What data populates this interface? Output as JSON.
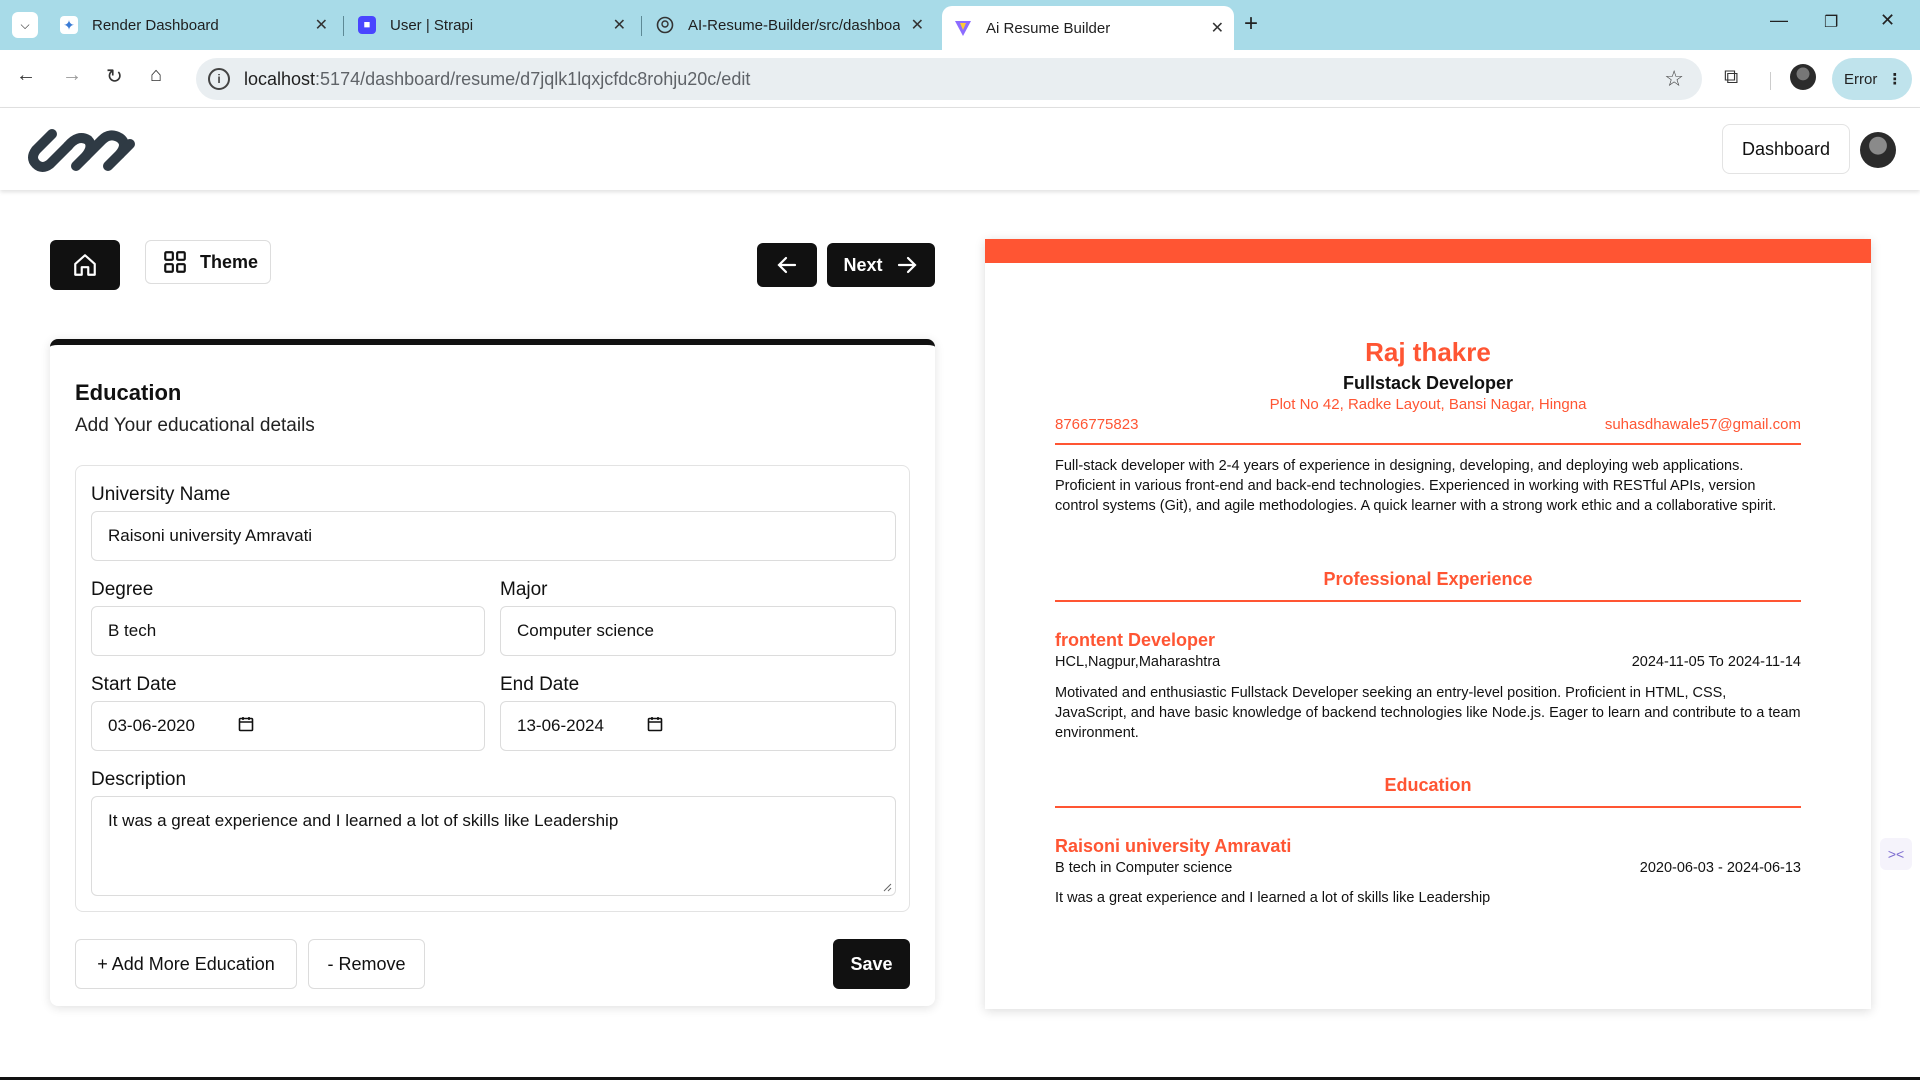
{
  "browser": {
    "tabs": [
      {
        "title": "Render Dashboard",
        "icon": "render-icon"
      },
      {
        "title": "User | Strapi",
        "icon": "strapi-icon"
      },
      {
        "title": "AI-Resume-Builder/src/dashboa",
        "icon": "github-icon"
      },
      {
        "title": "Ai Resume Builder",
        "icon": "vite-icon",
        "active": true
      }
    ],
    "url_host": "localhost",
    "url_path": ":5174/dashboard/resume/d7jqlk1lqxjcfdc8rohju20c/edit",
    "error_label": "Error"
  },
  "app": {
    "dashboard_label": "Dashboard"
  },
  "toolbar": {
    "theme_label": "Theme",
    "next_label": "Next"
  },
  "education_form": {
    "title": "Education",
    "subtitle": "Add Your educational details",
    "university_label": "University Name",
    "university_value": "Raisoni university Amravati",
    "degree_label": "Degree",
    "degree_value": "B tech",
    "major_label": "Major",
    "major_value": "Computer science",
    "start_label": "Start Date",
    "start_value": "03-06-2020",
    "end_label": "End Date",
    "end_value": "13-06-2024",
    "description_label": "Description",
    "description_value": "It was a great experience and I learned a lot of skills like Leadership",
    "add_label": "+ Add More Education",
    "remove_label": "- Remove",
    "save_label": "Save"
  },
  "preview": {
    "theme_color": "#ff5533",
    "name": "Raj thakre",
    "job_title": "Fullstack Developer",
    "address": "Plot No 42, Radke Layout, Bansi Nagar, Hingna",
    "phone": "8766775823",
    "email": "suhasdhawale57@gmail.com",
    "summary": "Full-stack developer with 2-4 years of experience in designing, developing, and deploying web applications. Proficient in various front-end and back-end technologies. Experienced in working with RESTful APIs, version control systems (Git), and agile methodologies. A quick learner with a strong work ethic and a collaborative spirit.",
    "experience_heading": "Professional Experience",
    "experience": {
      "title": "frontent Developer",
      "company": "HCL,Nagpur,Maharashtra",
      "dates": "2024-11-05 To 2024-11-14",
      "summary": " Motivated and enthusiastic Fullstack Developer seeking an entry-level position. Proficient in HTML, CSS, JavaScript, and have basic knowledge of backend technologies like Node.js. Eager to learn and contribute to a team environment."
    },
    "education_heading": "Education",
    "education": {
      "university": "Raisoni university Amravati",
      "degree": "B tech in Computer science",
      "dates": "2020-06-03 - 2024-06-13",
      "description": "It was a great experience and I learned a lot of skills like Leadership"
    }
  }
}
